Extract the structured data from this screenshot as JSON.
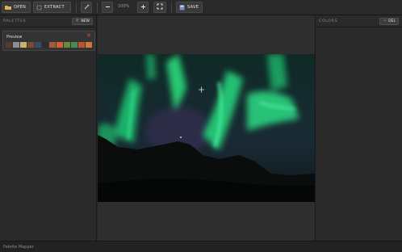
{
  "toolbar": {
    "open_label": "Open",
    "extract_label": "Extract",
    "zoom_level": "100%",
    "save_label": "Save"
  },
  "left_panel": {
    "title": "Palettes",
    "new_label": "New",
    "palette": {
      "name": "Preview",
      "swatches": [
        "#5a3a2c",
        "#8a8f99",
        "#c9b26a",
        "#7b4a2e",
        "#3a4a6a",
        "#2c2c2c",
        "#a55a3a",
        "#d0603a",
        "#6a8a3a",
        "#4a8a5a",
        "#c0502e",
        "#d07a3a"
      ]
    }
  },
  "right_panel": {
    "title": "Colors",
    "delete_label": "Del"
  },
  "status": {
    "text": "Palette Mapper"
  },
  "colors": {
    "accent_green": "#3fbf6a",
    "accent_red": "#e05a3a"
  }
}
